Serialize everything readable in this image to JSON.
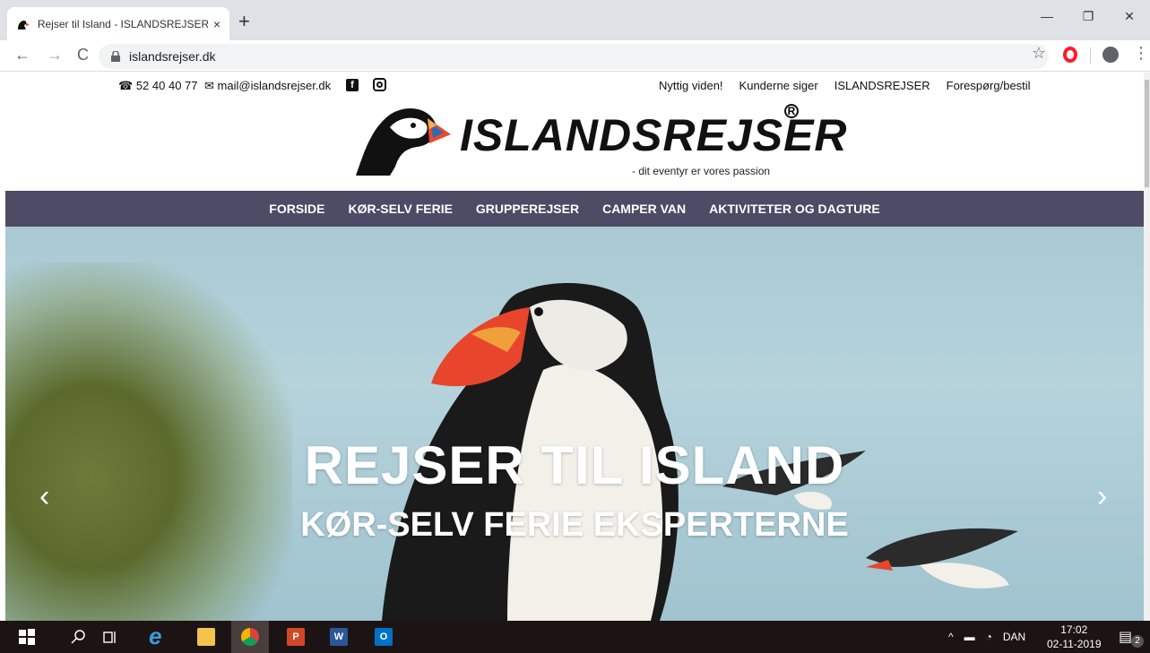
{
  "browser": {
    "tab_title": "Rejser til Island - ISLANDSREJSER",
    "tab_close": "×",
    "new_tab": "+",
    "url": "islandsrejser.dk",
    "back": "←",
    "forward": "→",
    "reload": "C",
    "star": "☆",
    "menu": "⋮",
    "window_controls": {
      "minimize": "—",
      "restore": "❐",
      "close": "✕"
    }
  },
  "topbar": {
    "phone": "52 40 40 77",
    "email": "mail@islandsrejser.dk",
    "facebook_glyph": "f",
    "links": [
      "Nyttig viden!",
      "Kunderne siger",
      "ISLANDSREJSER",
      "Forespørg/bestil"
    ]
  },
  "logo": {
    "brand": "ISLANDSREJSER",
    "registered": "R",
    "slogan": "- dit eventyr er vores passion"
  },
  "mainnav": [
    "FORSIDE",
    "KØR-SELV FERIE",
    "GRUPPEREJSER",
    "CAMPER VAN",
    "AKTIVITETER OG DAGTURE"
  ],
  "hero": {
    "title": "REJSER TIL ISLAND",
    "subtitle": "KØR-SELV FERIE EKSPERTERNE",
    "prev": "‹",
    "next": "›"
  },
  "taskbar": {
    "ie_glyph": "e",
    "ppt_glyph": "P",
    "word_glyph": "W",
    "outlook_glyph": "O",
    "tray_caret": "^",
    "language": "DAN",
    "time": "17:02",
    "date": "02-11-2019",
    "notifications": "2"
  },
  "colors": {
    "nav_bg": "#4e4b66",
    "opera_red": "#ff1b2d",
    "sky": "#a9c9d3"
  }
}
